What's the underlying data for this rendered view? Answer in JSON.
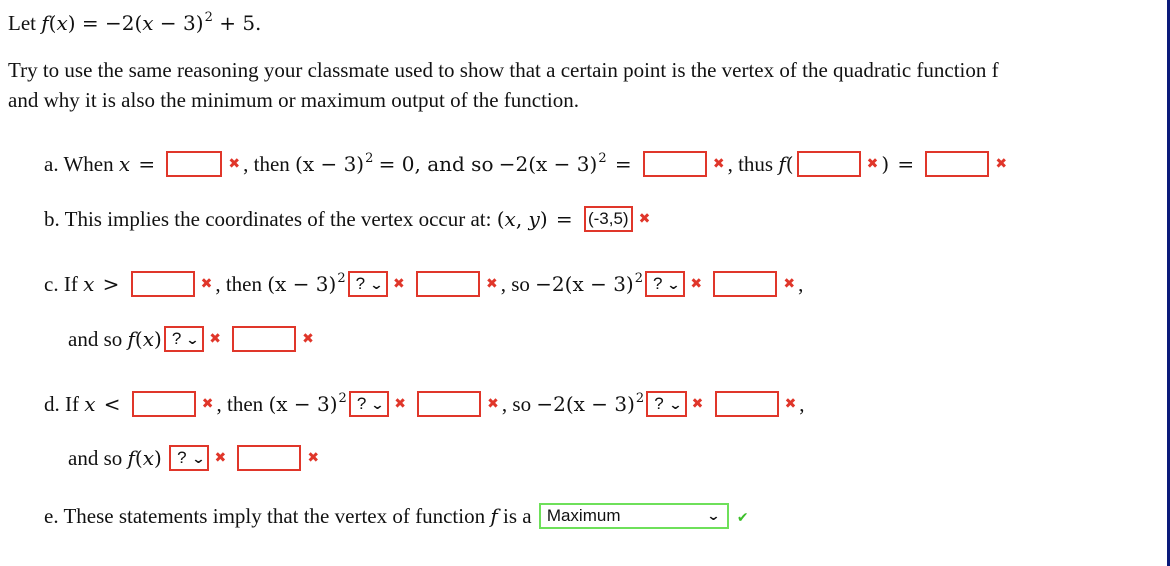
{
  "problem": {
    "let_text": "Let",
    "function_def": "f(x) = −2(x − 3)² + 5.",
    "instructions_line1": "Try to use the same reasoning your classmate used to show that a certain point is the vertex of the quadratic function f",
    "instructions_line2": "and why it is also the minimum or maximum output of the function."
  },
  "part_a": {
    "label": "a. When",
    "var": "x",
    "eq": "=",
    "then_text": ", then",
    "expr1": "(x − 3)",
    "exp": "2",
    "eq_zero": "= 0, and so",
    "expr2": "−2(x − 3)",
    "eq2": "=",
    "thus_text": ", thus",
    "f_open": "f(",
    "f_close": ")",
    "eq3": "=",
    "answers": [
      "",
      "",
      "",
      ""
    ]
  },
  "part_b": {
    "label": "b. This implies the coordinates of the vertex occur at:",
    "coords": "(x, y)",
    "eq": "=",
    "answer": "(-3,5)"
  },
  "part_c": {
    "label": "c. If",
    "var": "x",
    "op": ">",
    "then_text": ", then",
    "expr1": "(x − 3)",
    "exp": "2",
    "so_text": ", so",
    "expr2": "−2(x − 3)",
    "trail": ",",
    "and_so": "and so",
    "fx": "f(x)",
    "select1": "?",
    "select2": "?",
    "select3": "?",
    "answers": [
      "",
      "",
      "",
      ""
    ]
  },
  "part_d": {
    "label": "d. If",
    "var": "x",
    "op": "<",
    "then_text": ", then",
    "expr1": "(x − 3)",
    "exp": "2",
    "so_text": ", so",
    "expr2": "−2(x − 3)",
    "trail": ",",
    "and_so": "and so",
    "fx": "f(x)",
    "select1": "?",
    "select2": "?",
    "select3": "?",
    "answers": [
      "",
      "",
      "",
      ""
    ]
  },
  "part_e": {
    "label": "e. These statements imply that the vertex of function",
    "f": "f",
    "is_a": "is a",
    "select_value": "Maximum"
  },
  "icons": {
    "incorrect": "✖",
    "correct": "✔",
    "chevron": "∨"
  },
  "colors": {
    "incorrect": "#e0362a",
    "correct": "#6ee05a",
    "frame": "#0a1a7a"
  }
}
